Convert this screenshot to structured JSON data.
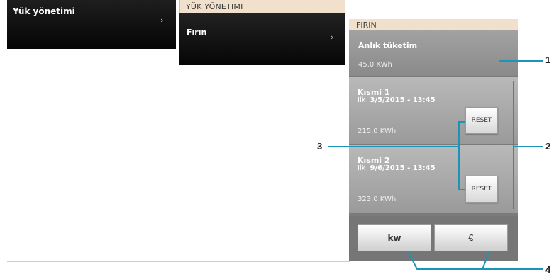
{
  "panel1": {
    "title": "Yük yönetimi",
    "chevron": "›"
  },
  "panel2": {
    "header": "YÜK YÖNETIMI",
    "item": "Fırın",
    "chevron": "›"
  },
  "device": {
    "header": "FIRIN",
    "consumption": {
      "label": "Anlık tüketim",
      "value": "45.0 KWh"
    },
    "parts": [
      {
        "name": "Kısmi 1",
        "first_label": "İlk",
        "date": "3/5/2015 - 13:45",
        "value": "215.0 KWh",
        "reset": "RESET"
      },
      {
        "name": "Kısmi 2",
        "first_label": "İlk",
        "date": "9/6/2015 - 13:45",
        "value": "323.0 KWh",
        "reset": "RESET"
      }
    ],
    "units": {
      "kw": "kw",
      "euro": "€"
    }
  },
  "callouts": [
    "1",
    "2",
    "3",
    "4"
  ],
  "colors": {
    "callout": "#1a95b7",
    "header_bg": "#f0e0cc"
  }
}
